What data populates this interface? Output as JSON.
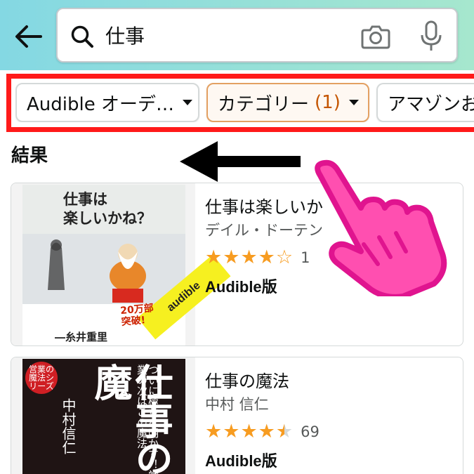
{
  "header": {
    "back_icon": "arrow-left-icon",
    "search_value": "仕事",
    "search_icon": "search-icon",
    "camera_icon": "camera-icon",
    "mic_icon": "mic-icon",
    "gradient_colors": [
      "#84d8e3",
      "#a6e7ce"
    ]
  },
  "filters": {
    "highlight_color": "#ff1a1a",
    "chips": [
      {
        "label": "Audible オーデ…"
      },
      {
        "label": "カテゴリー",
        "count": "(1)"
      },
      {
        "label": "アマゾンお"
      }
    ]
  },
  "results": {
    "heading": "結果",
    "items": [
      {
        "title": "仕事は楽しいか",
        "author": "デイル・ドーテン",
        "rating": 4,
        "rating_count_partial": "1",
        "format": "Audible版",
        "cover": {
          "title_lines": [
            "仕事は",
            "楽しいかね？"
          ],
          "author": "―糸井重里",
          "badge_lines": [
            "20万部",
            "突破!"
          ],
          "band": "audible"
        }
      },
      {
        "title": "仕事の魔法",
        "author": "中村 信仁",
        "rating": 4.5,
        "rating_count": "69",
        "format": "Audible版",
        "cover": {
          "title": "仕事の魔",
          "tagline": "ついに極意を明かす！営業の次はこの魔法",
          "author": "中村信仁",
          "circle": "営業の魔法シリーズ"
        }
      }
    ]
  },
  "annotations": {
    "arrow": "left-arrow-icon",
    "hand": "pointing-hand-icon",
    "hand_color": "#ff4fb0"
  }
}
